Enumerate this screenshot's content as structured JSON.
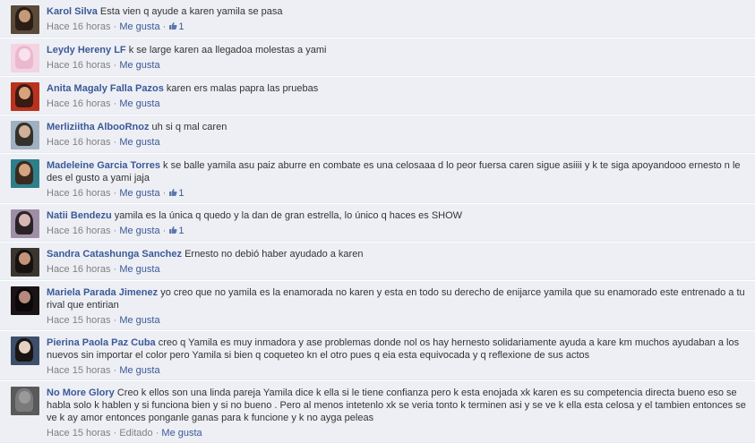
{
  "colors": {
    "link": "#3b5998",
    "comment_bg": "#edeff4",
    "meta": "#808080"
  },
  "comments": [
    {
      "author": "Karol Silva",
      "text": "Esta vien q ayude a karen yamila se pasa",
      "time": "Hace 16 horas",
      "like_label": "Me gusta",
      "likes": "1",
      "avatar": {
        "bg": "#5a4a3a",
        "hair": "#2a1e16",
        "face": "#c49a7a"
      }
    },
    {
      "author": "Leydy Hereny LF",
      "text": "k se large karen aa llegadoa molestas a yami",
      "time": "Hace 16 horas",
      "like_label": "Me gusta",
      "likes": "",
      "avatar": {
        "bg": "#f4d3e2",
        "hair": "#eab8cf",
        "face": "#f8e2ec"
      }
    },
    {
      "author": "Anita Magaly Falla Pazos",
      "text": "karen ers malas papra las pruebas",
      "time": "Hace 16 horas",
      "like_label": "Me gusta",
      "likes": "",
      "avatar": {
        "bg": "#b8321e",
        "hair": "#3a1a12",
        "face": "#d8a27c"
      }
    },
    {
      "author": "Merliziitha AlbooRnoz",
      "text": "uh si q mal caren",
      "time": "Hace 16 horas",
      "like_label": "Me gusta",
      "likes": "",
      "avatar": {
        "bg": "#9fb0c0",
        "hair": "#34302c",
        "face": "#d0b098"
      }
    },
    {
      "author": "Madeleine Garcia Torres",
      "text": "k se balle yamila asu paiz aburre en combate es una celosaaa d lo peor fuersa caren sigue asiiii y k te siga apoyandooo ernesto n le des el gusto a yami jaja",
      "time": "Hace 16 horas",
      "like_label": "Me gusta",
      "likes": "1",
      "avatar": {
        "bg": "#2f7f8a",
        "hair": "#3a2a1e",
        "face": "#d3a482"
      }
    },
    {
      "author": "Natii Bendezu",
      "text": "yamila es la única q quedo y la dan de gran estrella, lo único q haces es SHOW",
      "time": "Hace 16 horas",
      "like_label": "Me gusta",
      "likes": "1",
      "avatar": {
        "bg": "#9e8fa6",
        "hair": "#2b2228",
        "face": "#d7b7b4"
      }
    },
    {
      "author": "Sandra Catashunga Sanchez",
      "text": "Ernesto no debió haber ayudado a karen",
      "time": "Hace 16 horas",
      "like_label": "Me gusta",
      "likes": "",
      "avatar": {
        "bg": "#3b3530",
        "hair": "#151210",
        "face": "#c49478"
      }
    },
    {
      "author": "Mariela Parada Jimenez",
      "text": "yo creo que no yamila es la enamorada no karen y esta en todo su derecho de enijarce yamila que su enamorado este entrenado a tu rival que entirian",
      "time": "Hace 15 horas",
      "like_label": "Me gusta",
      "likes": "",
      "avatar": {
        "bg": "#1a1416",
        "hair": "#0c0809",
        "face": "#b48a7c"
      }
    },
    {
      "author": "Pierina Paola Paz Cuba",
      "text": "creo q Yamila es muy inmadora y ase problemas donde nol os hay hernesto solidariamente ayuda a kare km muchos ayudaban a los nuevos sin importar el color pero Yamila si bien q coqueteo kn el otro pues q eia esta equivocada y q reflexione de sus actos",
      "time": "Hace 15 horas",
      "like_label": "Me gusta",
      "likes": "",
      "avatar": {
        "bg": "#3d4f6a",
        "hair": "#1a1512",
        "face": "#e6d2c4"
      }
    },
    {
      "author": "No More Glory",
      "text": "Creo k ellos son una linda pareja Yamila dice k ella si le tiene confianza pero k esta enojada xk karen es su competencia directa bueno eso se habla solo k hablen y si funciona bien y si no bueno . Pero al menos intetenlo xk se veria tonto k terminen asi y se ve k ella esta celosa y el tambien entonces se ve k ay amor entonces ponganle ganas para k funcione y k no ayga peleas",
      "time": "Hace 15 horas",
      "edited": "Editado",
      "like_label": "Me gusta",
      "likes": "",
      "avatar": {
        "bg": "#5a5a5a",
        "hair": "#7a7a7a",
        "face": "#9a9a9a"
      }
    }
  ]
}
